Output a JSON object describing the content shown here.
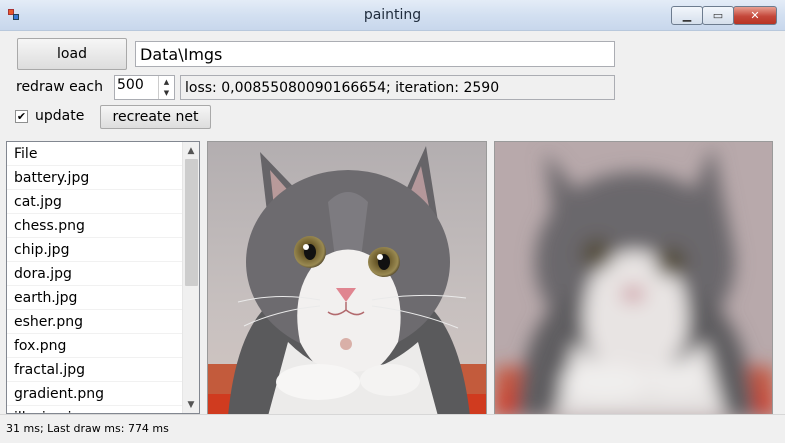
{
  "window": {
    "title": "painting"
  },
  "toolbar": {
    "load_label": "load",
    "path_value": "Data\\Imgs",
    "redraw_label": "redraw each",
    "redraw_value": "500",
    "loss_text": "loss: 0,00855080090166654; iteration: 2590",
    "update_label": "update",
    "update_checked": true,
    "recreate_label": "recreate net"
  },
  "file_list": {
    "header": "File",
    "items": [
      "battery.jpg",
      "cat.jpg",
      "chess.png",
      "chip.jpg",
      "dora.jpg",
      "earth.jpg",
      "esher.png",
      "fox.png",
      "fractal.jpg",
      "gradient.png",
      "illusion.jpg"
    ]
  },
  "status": {
    "text": "31 ms; Last draw ms: 774 ms"
  }
}
